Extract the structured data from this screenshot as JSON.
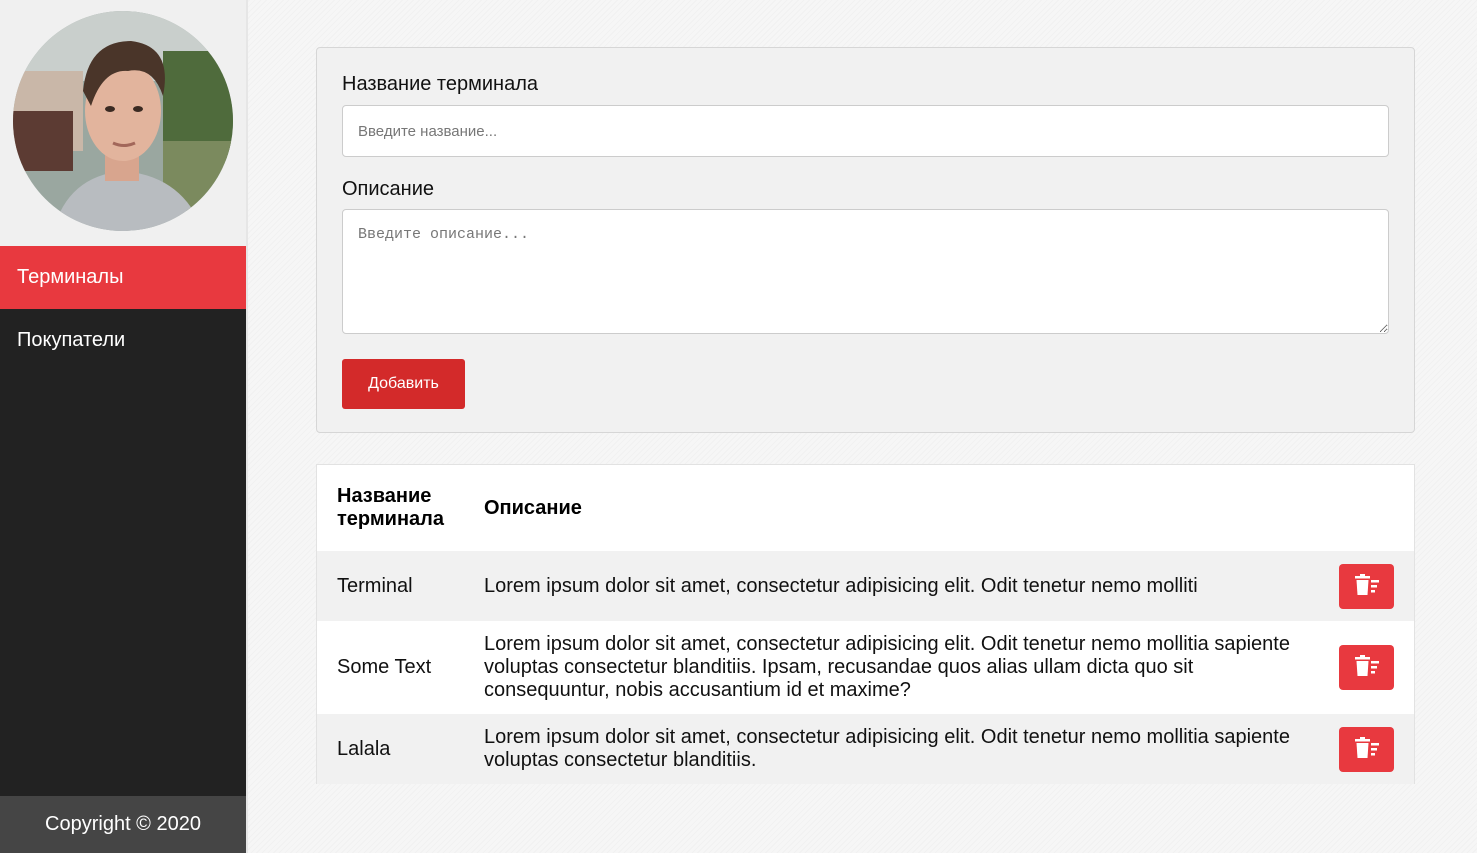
{
  "sidebar": {
    "nav": [
      {
        "label": "Терминалы",
        "active": true
      },
      {
        "label": "Покупатели",
        "active": false
      }
    ],
    "footer": "Copyright © 2020"
  },
  "form": {
    "name_label": "Название терминала",
    "name_placeholder": "Введите название...",
    "name_value": "",
    "description_label": "Описание",
    "description_placeholder": "Введите описание...",
    "description_value": "",
    "add_button": "Добавить"
  },
  "table": {
    "headers": [
      "Название терминала",
      "Описание"
    ],
    "rows": [
      {
        "name": "Terminal",
        "description": "Lorem ipsum dolor sit amet, consectetur adipisicing elit. Odit tenetur nemo molliti"
      },
      {
        "name": "Some Text",
        "description": "Lorem ipsum dolor sit amet, consectetur adipisicing elit. Odit tenetur nemo mollitia sapiente voluptas consectetur blanditiis. Ipsam, recusandae quos alias ullam dicta quo sit consequuntur, nobis accusantium id et maxime?"
      },
      {
        "name": "Lalala",
        "description": "Lorem ipsum dolor sit amet, consectetur adipisicing elit. Odit tenetur nemo mollitia sapiente voluptas consectetur blanditiis."
      }
    ],
    "row_action_icon": "trash-icon"
  },
  "colors": {
    "accent": "#e8393f",
    "button": "#d32a2a",
    "sidebar_bg": "#222222",
    "footer_bg": "#454545"
  }
}
